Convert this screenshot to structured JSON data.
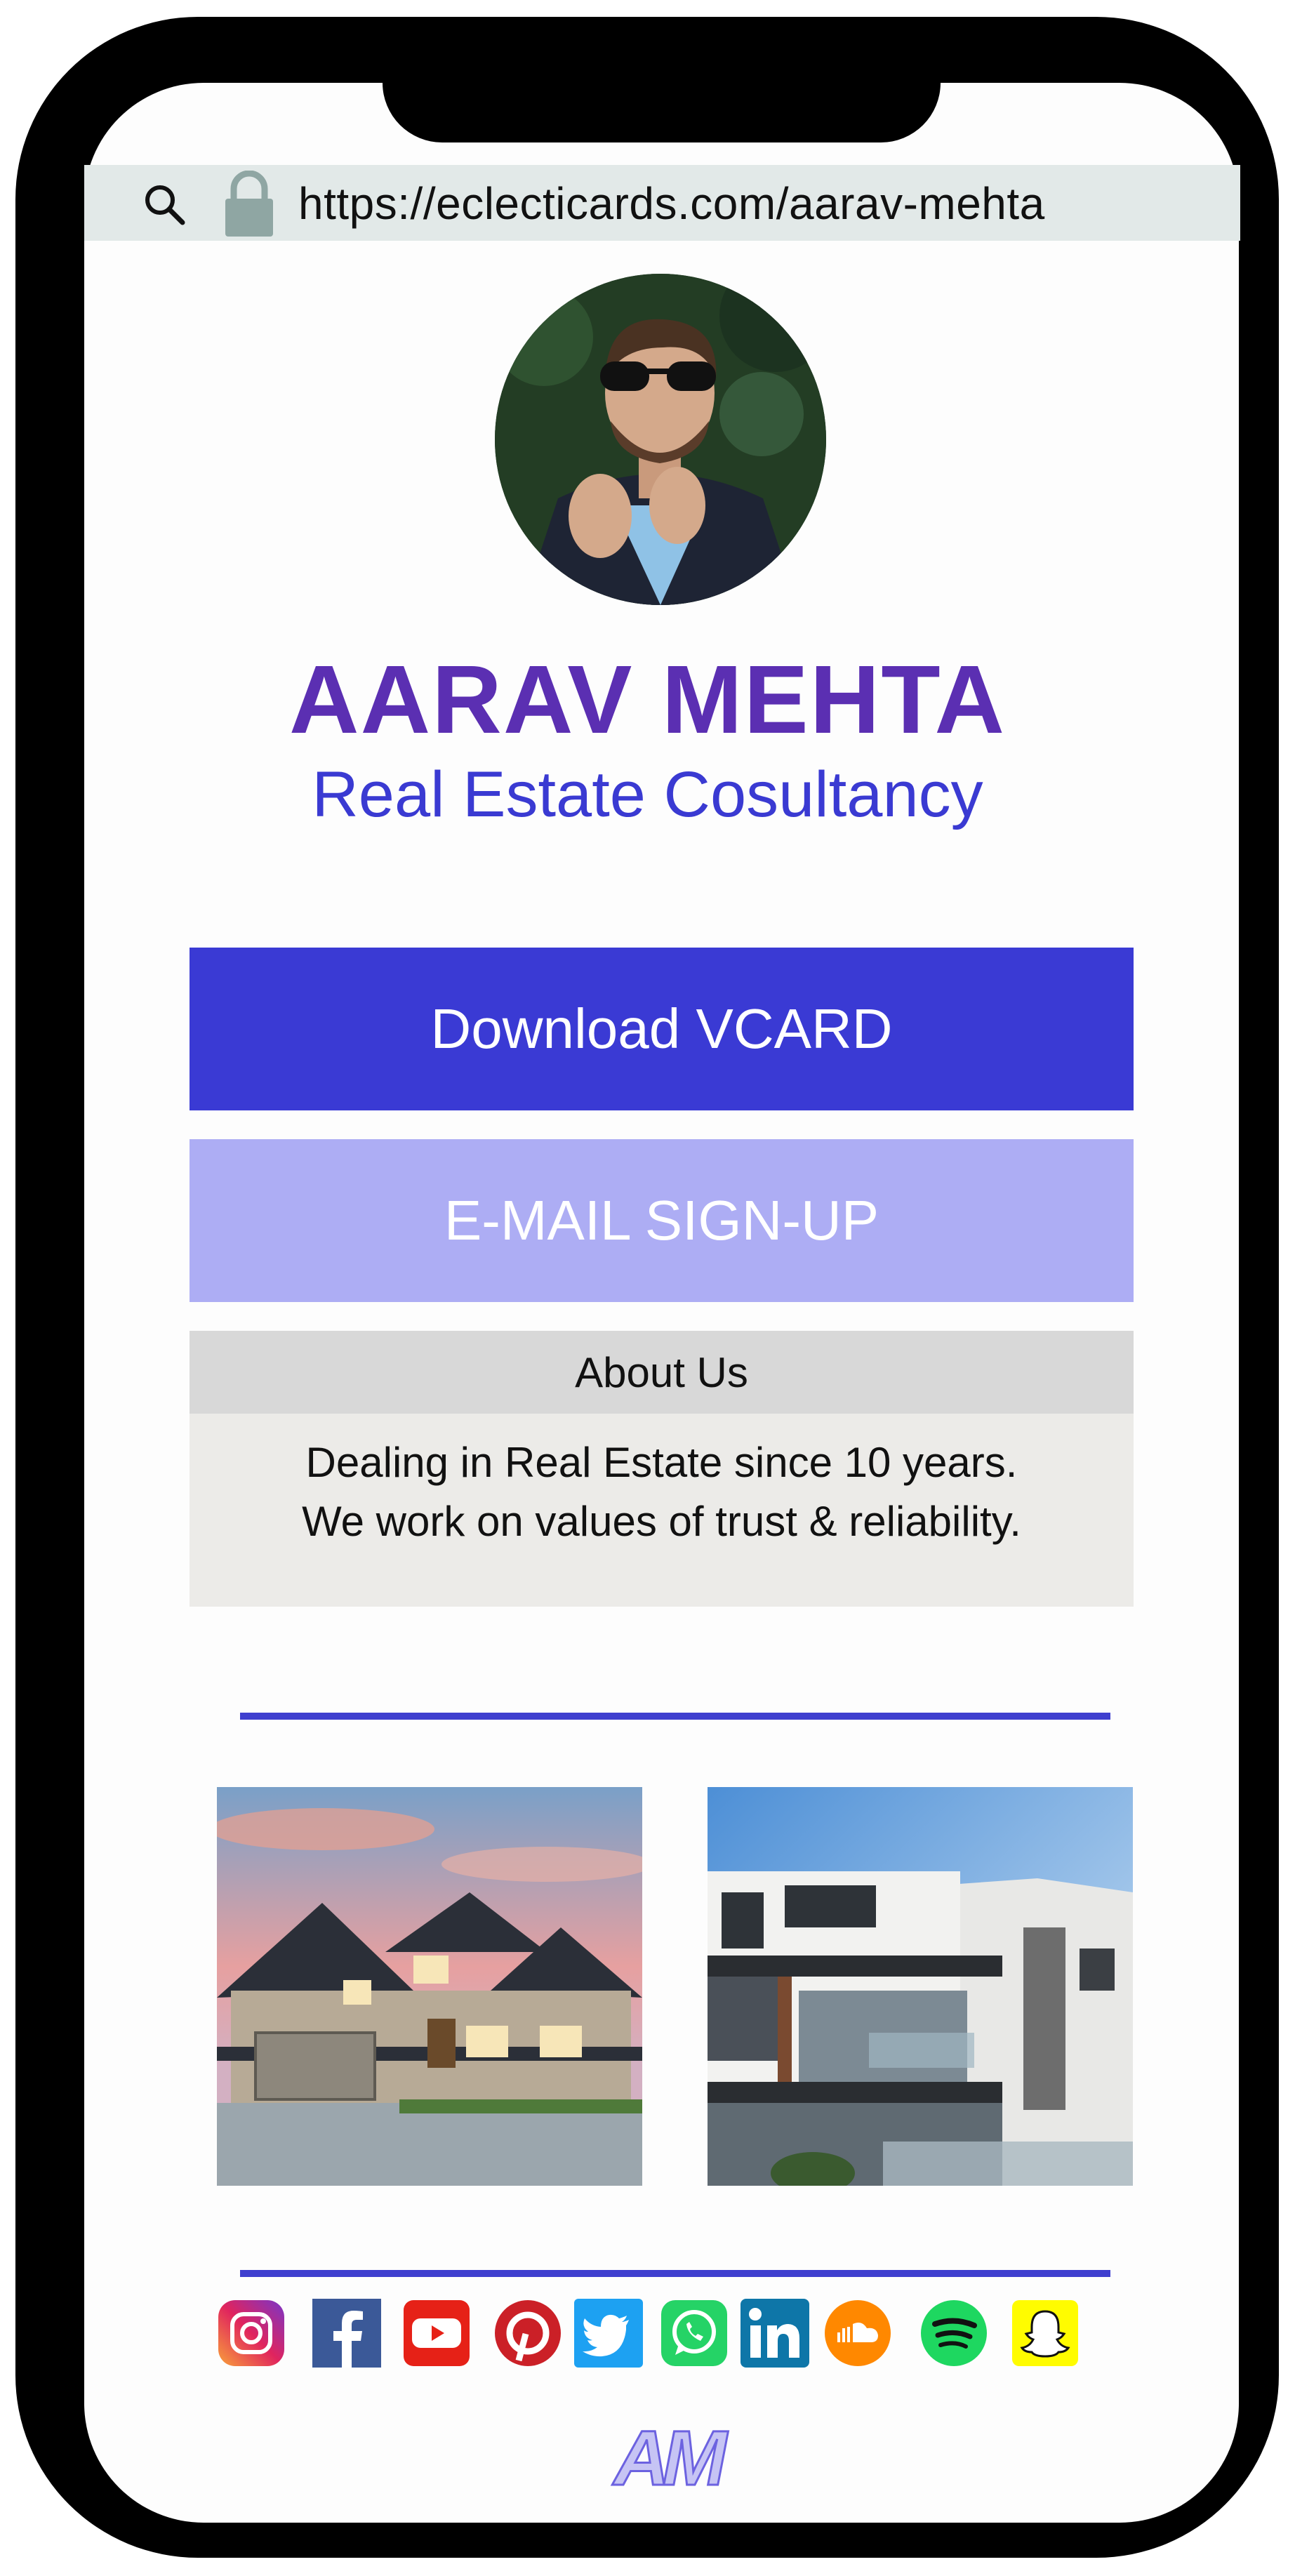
{
  "browser": {
    "url": "https://eclecticards.com/aarav-mehta"
  },
  "profile": {
    "name": "AARAV MEHTA",
    "tagline": "Real Estate Cosultancy"
  },
  "actions": {
    "download_vcard": "Download VCARD",
    "email_signup": "E-MAIL SIGN-UP"
  },
  "about": {
    "heading": "About Us",
    "line1": "Dealing in Real Estate since 10 years.",
    "line2": "We work on values of trust & reliability."
  },
  "gallery": {
    "images": [
      "house-photo",
      "modern-building-photo"
    ]
  },
  "socials": [
    {
      "icon": "instagram-icon",
      "color": "#d6246e"
    },
    {
      "icon": "facebook-icon",
      "color": "#3b5998"
    },
    {
      "icon": "youtube-icon",
      "color": "#e62117"
    },
    {
      "icon": "pinterest-icon",
      "color": "#cb2027"
    },
    {
      "icon": "twitter-icon",
      "color": "#1da1f2"
    },
    {
      "icon": "whatsapp-icon",
      "color": "#25d366"
    },
    {
      "icon": "linkedin-icon",
      "color": "#0e76a8"
    },
    {
      "icon": "soundcloud-icon",
      "color": "#ff8800"
    },
    {
      "icon": "spotify-icon",
      "color": "#1ed760"
    },
    {
      "icon": "snapchat-icon",
      "color": "#fffc00"
    }
  ],
  "footer": {
    "logo_text": "AM"
  },
  "colors": {
    "brand_purple": "#5b2fb2",
    "accent_blue": "#3a3ad4",
    "light_button": "#adadf4",
    "url_bar": "#e2e9e8"
  }
}
